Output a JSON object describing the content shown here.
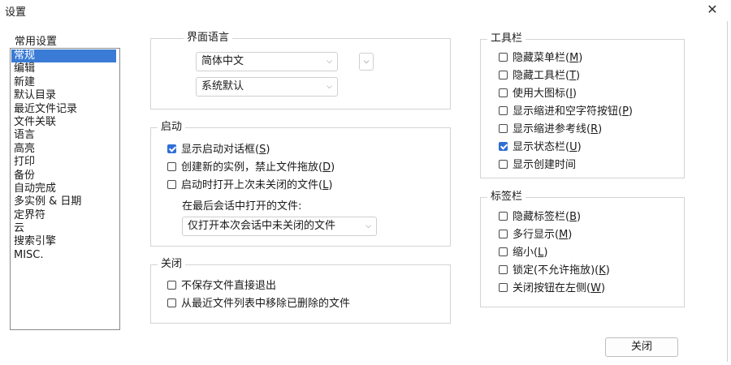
{
  "window": {
    "title": "设置",
    "close_glyph": "✕"
  },
  "sidebar": {
    "heading": "常用设置",
    "items": [
      "常规",
      "编辑",
      "新建",
      "默认目录",
      "最近文件记录",
      "文件关联",
      "语言",
      "高亮",
      "打印",
      "备份",
      "自动完成",
      "多实例 & 日期",
      "定界符",
      "云",
      "搜索引擎",
      "MISC."
    ],
    "selected_index": 0
  },
  "language_group": {
    "legend": "界面语言",
    "language_value": "简体中文",
    "region_value": "系统默认"
  },
  "startup_group": {
    "legend": "启动",
    "options": [
      {
        "pre": "显示启动对话框(",
        "key": "S",
        "post": ")",
        "checked": true
      },
      {
        "pre": "创建新的实例，禁止文件拖放(",
        "key": "D",
        "post": ")",
        "checked": false
      },
      {
        "pre": "启动时打开上次未关闭的文件(",
        "key": "L",
        "post": ")",
        "checked": false
      }
    ],
    "last_session_label": "在最后会话中打开的文件:",
    "last_session_value": "仅打开本次会话中未关闭的文件"
  },
  "close_group": {
    "legend": "关闭",
    "options": [
      {
        "label": "不保存文件直接退出",
        "checked": false
      },
      {
        "label": "从最近文件列表中移除已删除的文件",
        "checked": false
      }
    ]
  },
  "toolbar_group": {
    "legend": "工具栏",
    "options": [
      {
        "pre": "隐藏菜单栏(",
        "key": "M",
        "post": ")",
        "checked": false
      },
      {
        "pre": "隐藏工具栏(",
        "key": "T",
        "post": ")",
        "checked": false
      },
      {
        "pre": "使用大图标(",
        "key": "I",
        "post": ")",
        "checked": false
      },
      {
        "pre": "显示缩进和空字符按钮(",
        "key": "P",
        "post": ")",
        "checked": false
      },
      {
        "pre": "显示缩进参考线(",
        "key": "R",
        "post": ")",
        "checked": false
      },
      {
        "pre": "显示状态栏(",
        "key": "U",
        "post": ")",
        "checked": true
      },
      {
        "pre": "显示创建时间",
        "key": "",
        "post": "",
        "checked": false
      }
    ]
  },
  "tabbar_group": {
    "legend": "标签栏",
    "options": [
      {
        "pre": "隐藏标签栏(",
        "key": "B",
        "post": ")",
        "checked": false
      },
      {
        "pre": "多行显示(",
        "key": "M",
        "post": ")",
        "checked": false
      },
      {
        "pre": "缩小(",
        "key": "L",
        "post": ")",
        "checked": false
      },
      {
        "pre": "锁定(不允许拖放)(",
        "key": "K",
        "post": ")",
        "checked": false
      },
      {
        "pre": "关闭按钮在左侧(",
        "key": "W",
        "post": ")",
        "checked": false
      }
    ]
  },
  "footer": {
    "close_button": "关闭"
  },
  "icons": {
    "dropdown": "chevron-down-icon",
    "check": "check-icon"
  },
  "colors": {
    "selection": "#3a7bd5",
    "checkbox_on": "#2f6fd6"
  }
}
